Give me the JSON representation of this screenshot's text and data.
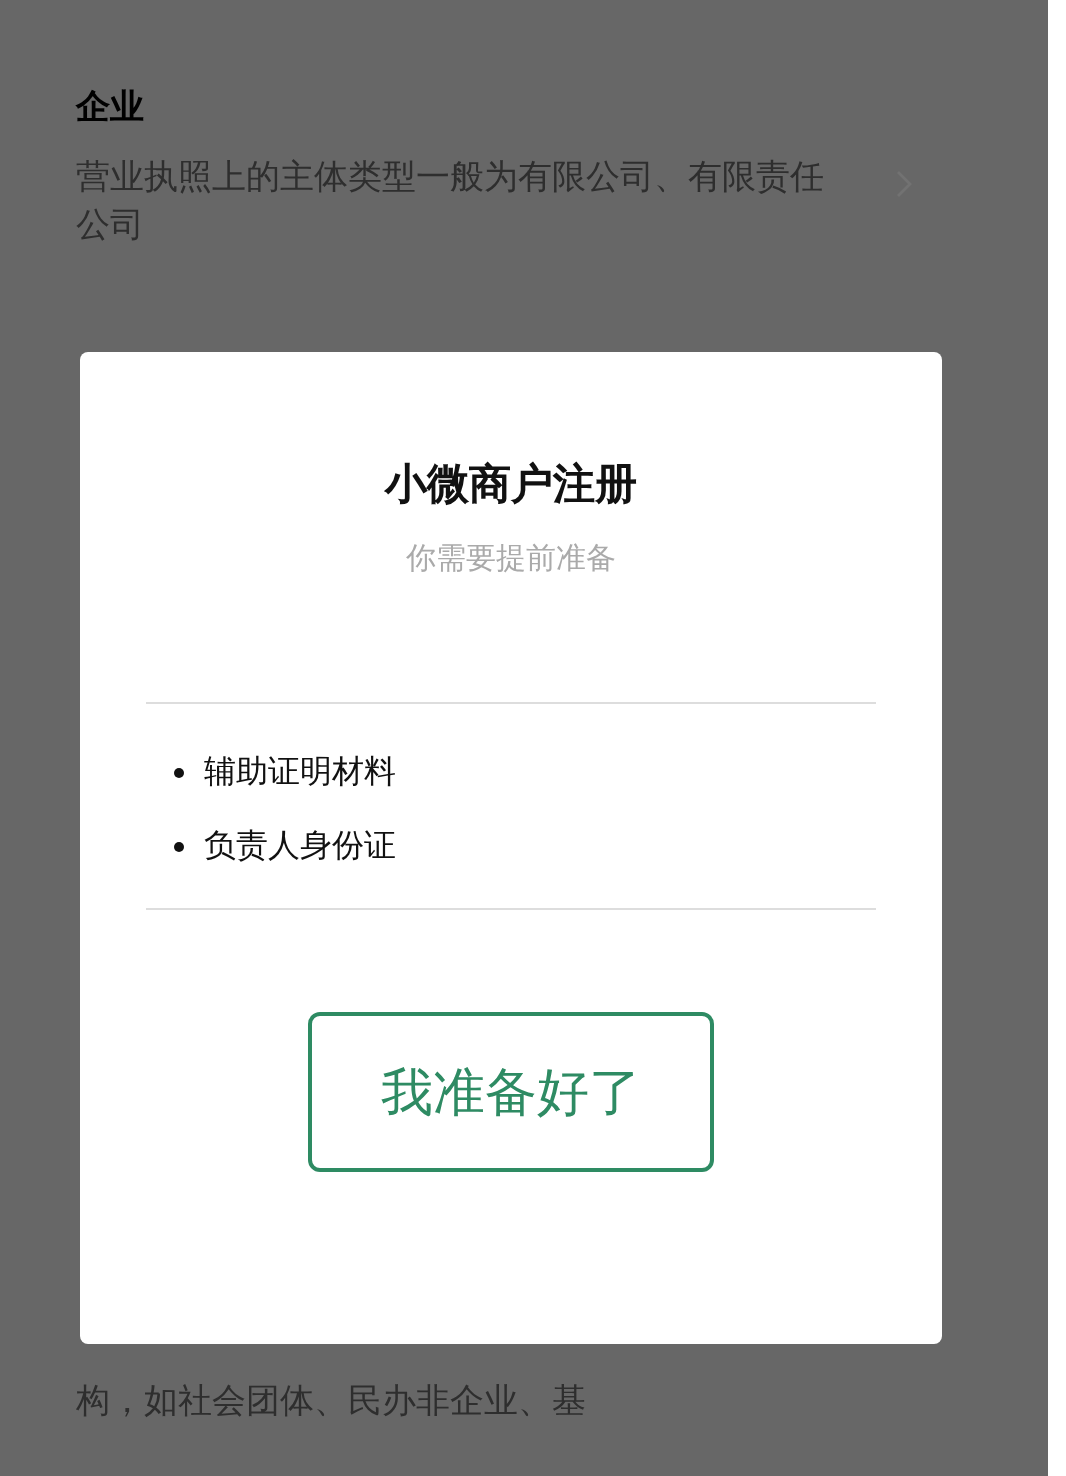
{
  "background": {
    "section_title": "企业",
    "section_description": "营业执照上的主体类型一般为有限公司、有限责任公司",
    "bottom_text": "构，如社会团体、民办非企业、基"
  },
  "dialog": {
    "title": "小微商户注册",
    "subtitle": "你需要提前准备",
    "items": [
      "辅助证明材料",
      "负责人身份证"
    ],
    "button": "我准备好了"
  }
}
